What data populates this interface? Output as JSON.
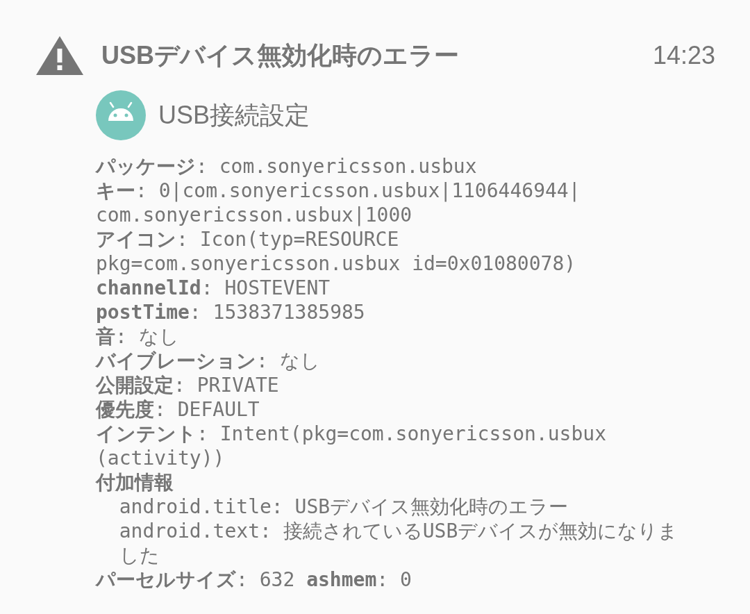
{
  "notification": {
    "title": "USBデバイス無効化時のエラー",
    "time": "14:23",
    "app_name": "USB接続設定"
  },
  "details": [
    {
      "kind": "field",
      "key": "パッケージ",
      "lines": [
        ": com.sonyericsson.usbux"
      ]
    },
    {
      "kind": "field",
      "key": "キー",
      "lines": [
        ": 0|com.sonyericsson.usbux|1106446944|",
        "com.sonyericsson.usbux|1000"
      ]
    },
    {
      "kind": "field",
      "key": "アイコン",
      "lines": [
        ": Icon(typ=RESOURCE",
        "pkg=com.sonyericsson.usbux id=0x01080078)"
      ]
    },
    {
      "kind": "field",
      "key": "channelId",
      "lines": [
        ": HOSTEVENT"
      ]
    },
    {
      "kind": "field",
      "key": "postTime",
      "lines": [
        ": 1538371385985"
      ]
    },
    {
      "kind": "field",
      "key": "音",
      "lines": [
        ": なし"
      ]
    },
    {
      "kind": "field",
      "key": "バイブレーション",
      "lines": [
        ": なし"
      ]
    },
    {
      "kind": "field",
      "key": "公開設定",
      "lines": [
        ": PRIVATE"
      ]
    },
    {
      "kind": "field",
      "key": "優先度",
      "lines": [
        ": DEFAULT"
      ]
    },
    {
      "kind": "field",
      "key": "インテント",
      "lines": [
        ": Intent(pkg=com.sonyericsson.usbux",
        "(activity))"
      ]
    },
    {
      "kind": "heading",
      "key": "付加情報"
    },
    {
      "kind": "extra",
      "key": "android.title",
      "lines": [
        ": USBデバイス無効化時のエラー"
      ]
    },
    {
      "kind": "extra",
      "key": "android.text",
      "lines": [
        ": 接続されているUSBデバイスが無効になりま",
        "した"
      ]
    },
    {
      "kind": "field",
      "key": "パーセルサイズ",
      "lines": [
        ": 632 **ashmem**: 0"
      ]
    }
  ]
}
